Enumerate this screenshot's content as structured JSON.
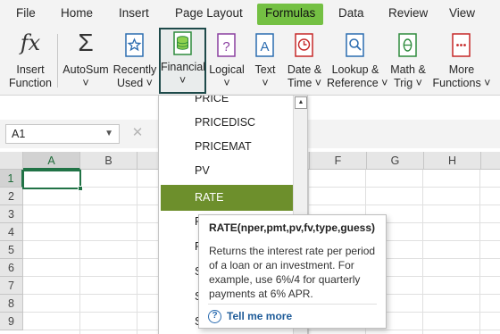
{
  "tabs": [
    "File",
    "Home",
    "Insert",
    "Page Layout",
    "Formulas",
    "Data",
    "Review",
    "View"
  ],
  "ribbon": {
    "insert_function": [
      "Insert",
      "Function"
    ],
    "autosum": [
      "AutoSum",
      "˅"
    ],
    "recently_used": [
      "Recently",
      "Used ˅"
    ],
    "financial": [
      "Financial",
      "˅"
    ],
    "logical": [
      "Logical",
      "˅"
    ],
    "text": [
      "Text",
      "˅"
    ],
    "date_time": [
      "Date &",
      "Time ˅"
    ],
    "lookup": [
      "Lookup &",
      "Reference ˅"
    ],
    "math": [
      "Math &",
      "Trig ˅"
    ],
    "more": [
      "More",
      "Functions ˅"
    ]
  },
  "formula_bar": {
    "name_box": "A1",
    "cancel": "✕"
  },
  "columns": [
    "A",
    "B",
    "",
    "",
    "F",
    "G",
    "H"
  ],
  "rows": [
    "1",
    "2",
    "3",
    "4",
    "5",
    "6",
    "7",
    "8",
    "9"
  ],
  "dropdown": {
    "items": [
      "PRICE",
      "PRICEDISC",
      "PRICEMAT",
      "PV",
      "RATE",
      "R",
      "R",
      "S",
      "S",
      "S"
    ],
    "highlighted": "RATE"
  },
  "tooltip": {
    "signature": "RATE(nper,pmt,pv,fv,type,guess)",
    "description": "Returns the interest rate per period of a loan or an investment. For example, use 6%/4 for quarterly payments at 6% APR.",
    "link": "Tell me more"
  },
  "colors": {
    "accent": "#217346",
    "active_tab": "#74c043",
    "highlight": "#6d8f2c"
  }
}
